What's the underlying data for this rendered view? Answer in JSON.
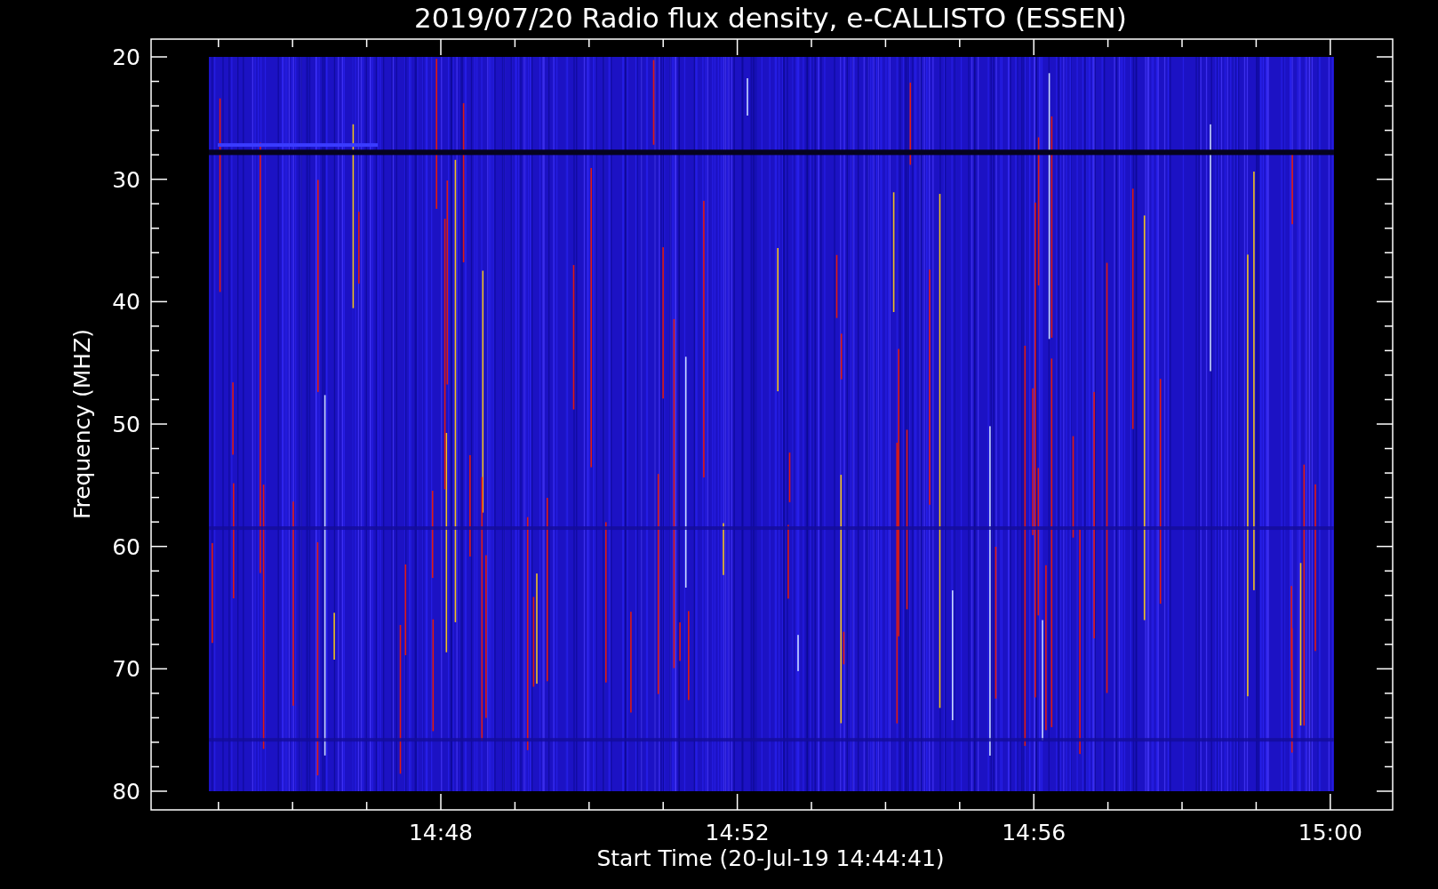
{
  "plot": {
    "title": "2019/07/20  Radio flux density, e-CALLISTO (ESSEN)",
    "ylabel": "Frequency (MHZ)",
    "xlabel": "Start Time (20-Jul-19 14:44:41)",
    "y_tick_labels": [
      "20",
      "30",
      "40",
      "50",
      "60",
      "70",
      "80"
    ],
    "x_tick_labels": [
      "14:48",
      "14:52",
      "14:56",
      "15:00"
    ]
  }
}
